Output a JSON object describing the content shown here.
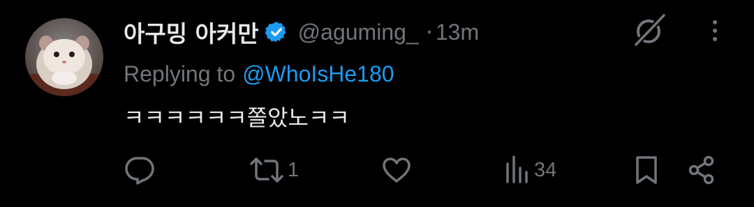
{
  "user": {
    "display_name": "아구밍 아커만",
    "handle": "@aguming_",
    "separator": "·",
    "timestamp": "13m"
  },
  "reply": {
    "prefix": "Replying to",
    "mention": "@WhoIsHe180"
  },
  "tweet": {
    "text": "ㅋㅋㅋㅋㅋㅋ쫄았노ㅋㅋ"
  },
  "actions": {
    "retweet_count": "1",
    "views_count": "34"
  },
  "colors": {
    "background": "#000000",
    "text": "#e7e9ea",
    "secondary": "#71767b",
    "accent": "#1d9bf0"
  },
  "icons": [
    "grok-icon",
    "more-icon",
    "reply-icon",
    "retweet-icon",
    "like-icon",
    "views-icon",
    "bookmark-icon",
    "share-icon",
    "verified-badge-icon"
  ]
}
